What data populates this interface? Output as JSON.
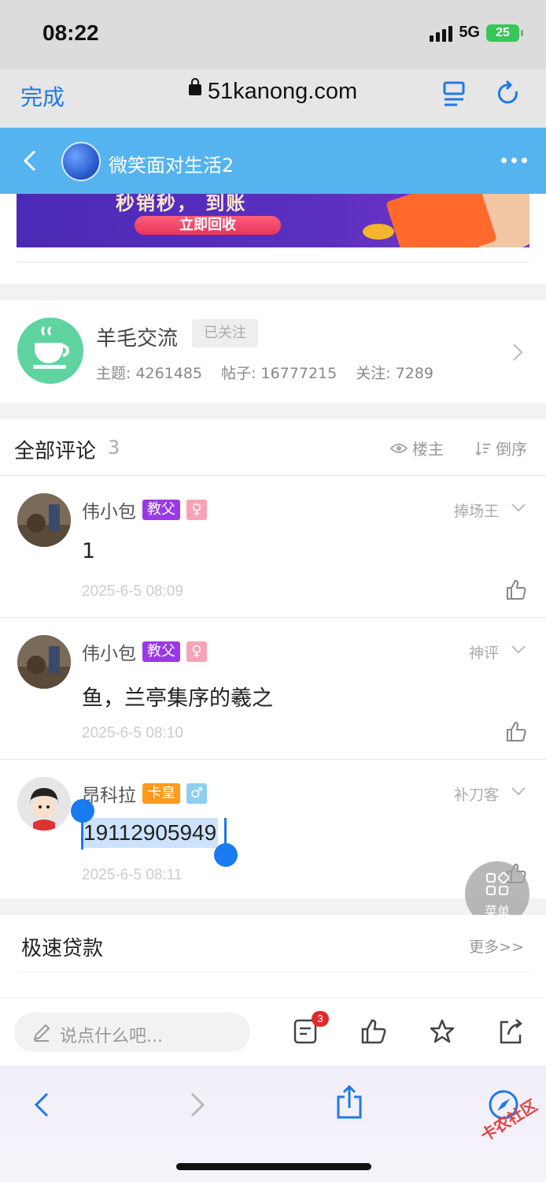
{
  "status": {
    "time": "08:22",
    "network": "5G",
    "battery": "25"
  },
  "browser": {
    "done": "完成",
    "url": "51kanong.com"
  },
  "thread": {
    "title": "微笑面对生活2"
  },
  "banner": {
    "text": "秒销秒， 到账",
    "button": "立即回收"
  },
  "forum": {
    "name": "羊毛交流",
    "follow_status": "已关注",
    "stats": [
      "主题: 4261485",
      "帖子: 16777215",
      "关注: 7289"
    ]
  },
  "comments": {
    "title": "全部评论",
    "count": "3",
    "filter_op": "楼主",
    "filter_sort": "倒序",
    "items": [
      {
        "name": "伟小包",
        "badge": "教父",
        "badge_color": "#9a38e8",
        "gender": "♀",
        "gender_color": "#f7a3b5",
        "title": "捧场王",
        "text": "1",
        "time": "2025-6-5 08:09"
      },
      {
        "name": "伟小包",
        "badge": "教父",
        "badge_color": "#9a38e8",
        "gender": "♀",
        "gender_color": "#f7a3b5",
        "title": "神评",
        "text": "鱼，兰亭集序的羲之",
        "time": "2025-6-5 08:10"
      },
      {
        "name": "昂科拉",
        "badge": "卡皇",
        "badge_color": "#ff9a1a",
        "gender": "♂",
        "gender_color": "#8ccff2",
        "title": "补刀客",
        "text": "19112905949",
        "time": "2025-6-5 08:11"
      }
    ]
  },
  "float_menu": {
    "label": "菜单"
  },
  "loan": {
    "title": "极速贷款",
    "more": "更多>>"
  },
  "reply": {
    "placeholder": "说点什么吧...",
    "notification_count": "3"
  },
  "watermark": "卡农社区",
  "colors": {
    "accent": "#1f7ae6",
    "header": "#55b4ef",
    "selection": "#1a7af0"
  }
}
